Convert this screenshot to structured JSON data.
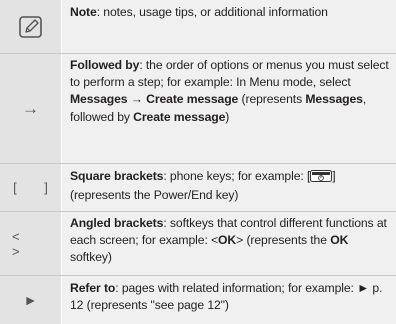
{
  "rows": [
    {
      "icon": "note-pencil-icon",
      "term": "Note",
      "desc": ": notes, usage tips, or additional information"
    },
    {
      "icon": "right-arrow-icon",
      "symbol": "→",
      "term": "Followed by",
      "desc_1": ": the order of options or menus you must select to perform a step; for example: In Menu mode, select ",
      "bold_1": "Messages → Create message",
      "desc_2": " (represents ",
      "bold_2": "Messages",
      "desc_3": ", followed by ",
      "bold_3": "Create message",
      "desc_4": ")"
    },
    {
      "icon": "square-brackets-icon",
      "symbol": "[ ]",
      "term": "Square brackets",
      "desc_1": ": phone keys; for example: [",
      "key_icon": "power-end-key-icon",
      "desc_2": "] (represents the Power/End key)"
    },
    {
      "icon": "angled-brackets-icon",
      "symbol": "< >",
      "term": "Angled brackets",
      "desc_1": ": softkeys that control different functions at each screen; for example: <",
      "bold_1": "OK",
      "desc_2": "> (represents the ",
      "bold_2": "OK",
      "desc_3": " softkey)"
    },
    {
      "icon": "play-triangle-icon",
      "symbol": "►",
      "term": "Refer to",
      "desc_1": ": pages with related information; for example: ",
      "ref_symbol": "►",
      "desc_2": " p. 12 (represents \"see page 12\")"
    }
  ]
}
